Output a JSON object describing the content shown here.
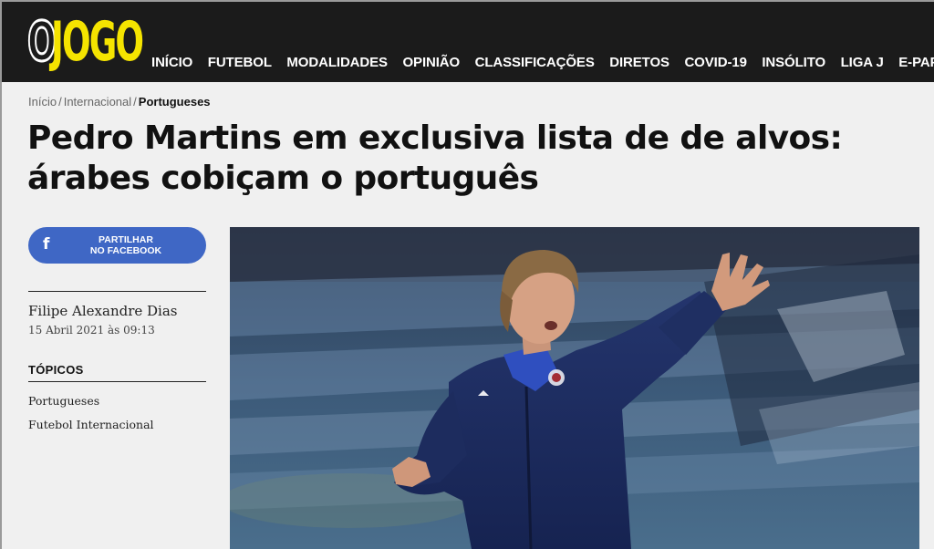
{
  "header": {
    "logo_o": "O",
    "logo_rest": "JOGO",
    "nav": [
      "INÍCIO",
      "FUTEBOL",
      "MODALIDADES",
      "OPINIÃO",
      "CLASSIFICAÇÕES",
      "DIRETOS",
      "COVID-19",
      "INSÓLITO",
      "LIGA J",
      "E-PAPE"
    ]
  },
  "breadcrumb": {
    "items": [
      "Início",
      "Internacional"
    ],
    "separator": "/",
    "current": "Portugueses"
  },
  "article": {
    "title_line1": "Pedro Martins em exclusiva lista de de alvos:",
    "title_line2": "árabes cobiçam o português",
    "share": {
      "icon": "f",
      "line1": "PARTILHAR",
      "line2": "NO FACEBOOK"
    },
    "author": "Filipe Alexandre Dias",
    "date": "15 Abril 2021 às 09:13",
    "topics_heading": "TÓPICOS",
    "topics": [
      "Portugueses",
      "Futebol Internacional"
    ]
  },
  "colors": {
    "header_bg": "#1b1b1b",
    "logo_yellow": "#f5e400",
    "facebook_blue": "#3f67c5"
  }
}
